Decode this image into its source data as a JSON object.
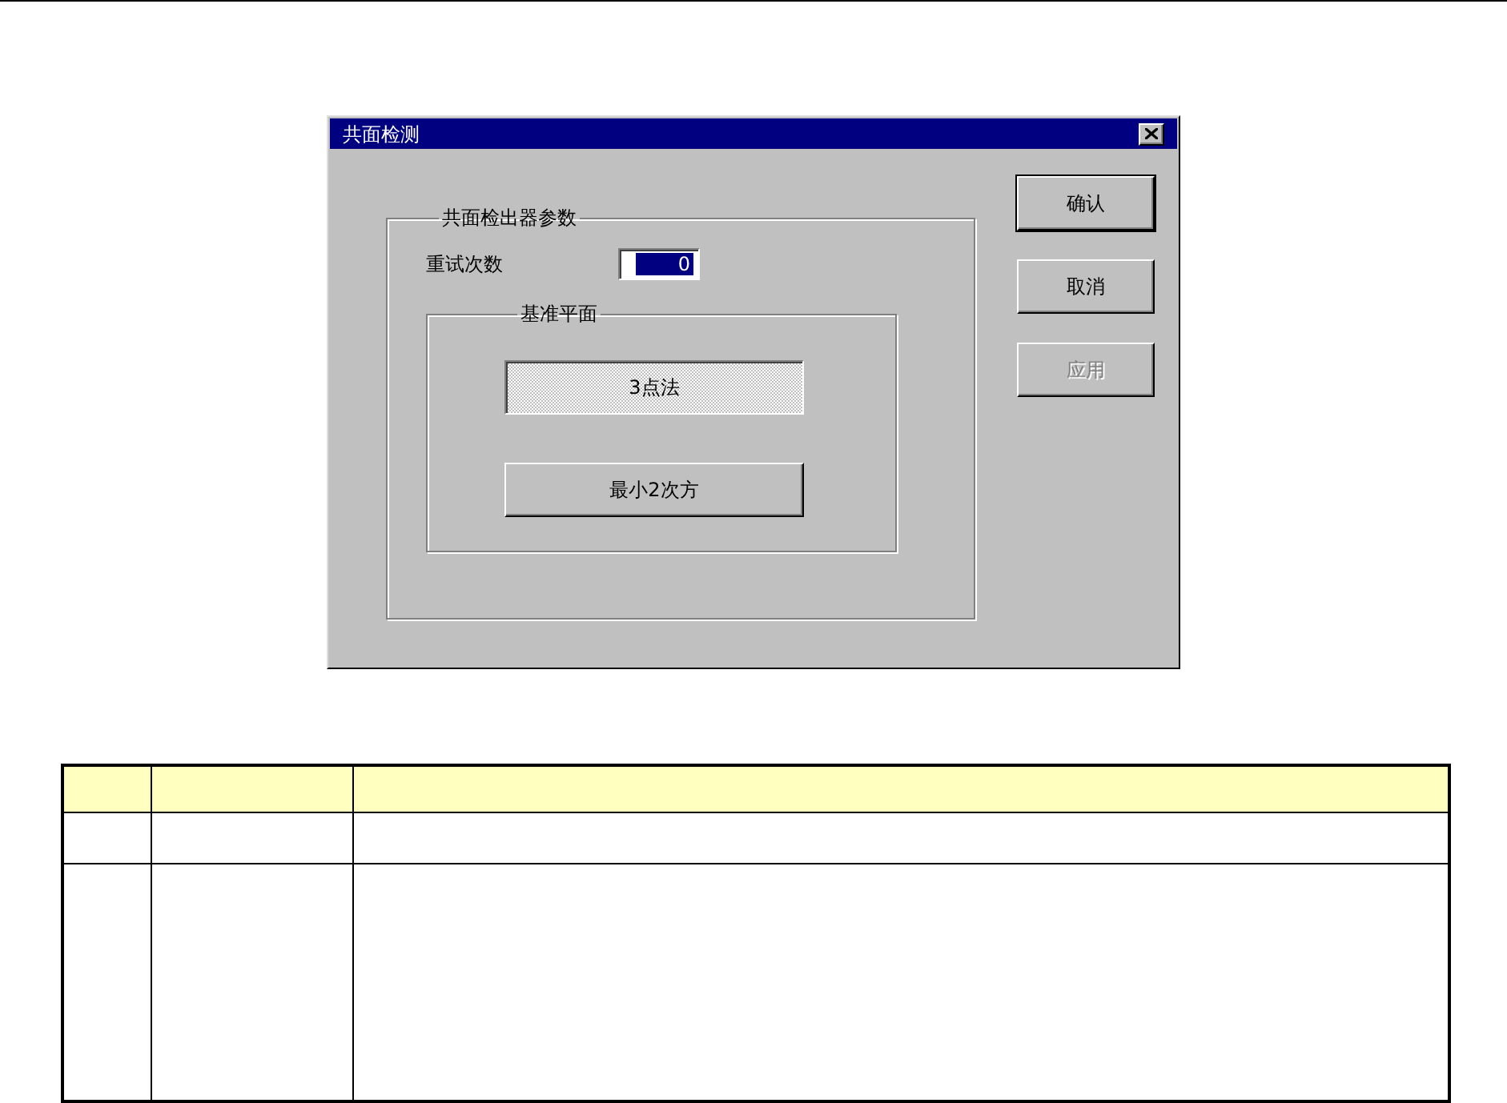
{
  "window": {
    "title": "共面检测"
  },
  "parameters_group": {
    "title": "共面检出器参数",
    "retry": {
      "label": "重试次数",
      "value": "0",
      "selected": true
    },
    "plane_group": {
      "title": "基准平面",
      "options": [
        {
          "label": "3点法",
          "selected": true
        },
        {
          "label": "最小2次方",
          "selected": false
        }
      ]
    }
  },
  "buttons": [
    {
      "label": "确认",
      "default": true,
      "disabled": false
    },
    {
      "label": "取消",
      "default": false,
      "disabled": false
    },
    {
      "label": "应用",
      "default": false,
      "disabled": true
    }
  ]
}
